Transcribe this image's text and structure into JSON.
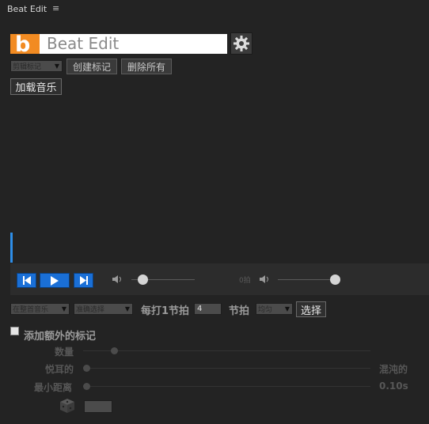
{
  "panel": {
    "title": "Beat Edit",
    "menu_glyph": "≡"
  },
  "header": {
    "logo_letter": "b",
    "title": "Beat Edit",
    "settings_icon": "gear-icon"
  },
  "toolbar": {
    "mode_select": "剪辑标记",
    "create_label": "创建标记",
    "delete_all_label": "删除所有"
  },
  "load_music_label": "加载音乐",
  "transport": {
    "volume_level": 0.16,
    "volume2_level": 1.0,
    "beat_label": "0拍",
    "icons": [
      "skip-back-icon",
      "play-icon",
      "skip-forward-icon"
    ]
  },
  "controls": {
    "scope_select": "在整首音乐",
    "precision_select": "准确选择",
    "beats_per_label": "每打1节拍",
    "beats_value": "4",
    "beat_unit": "节拍",
    "dist_select": "均匀",
    "select_label": "选择"
  },
  "extra": {
    "add_extra_label": "添加额外的标记",
    "count_label": "数量",
    "pleasant_label": "悦耳的",
    "chaotic_label": "混沌的",
    "min_dist_label": "最小距离",
    "min_dist_value": "0.10s",
    "count_level": 0.1,
    "pleasant_level": 0.0,
    "min_dist_level": 0.0
  }
}
